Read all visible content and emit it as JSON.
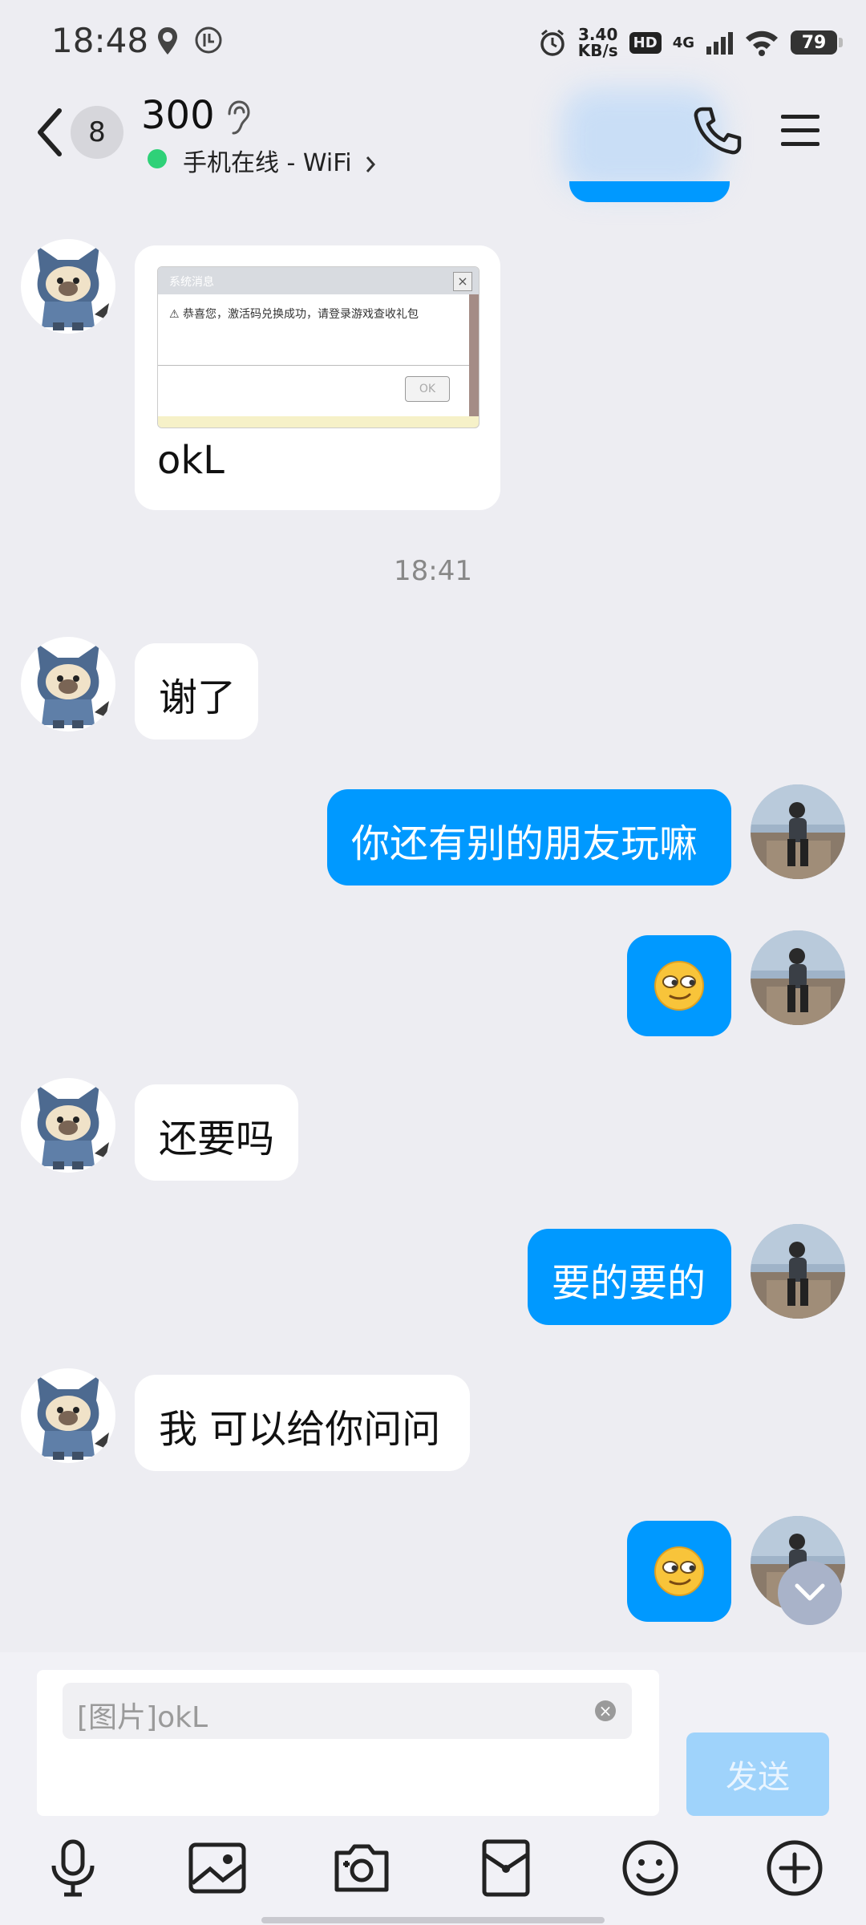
{
  "status_bar": {
    "time": "18:48",
    "net_speed_value": "3.40",
    "net_speed_unit": "KB/s",
    "hd": "HD",
    "signal_type": "4G",
    "battery": "79"
  },
  "header": {
    "unread_count": "8",
    "contact_name": "300",
    "online_status": "手机在线 - WiFi"
  },
  "messages": [
    {
      "side": "in",
      "type": "image",
      "caption": "okL",
      "image": {
        "window_title": "系统消息",
        "text": "恭喜您，激活码兑换成功，请登录游戏查收礼包",
        "button": "OK"
      }
    },
    {
      "type": "timestamp",
      "text": "18:41"
    },
    {
      "side": "in",
      "text": "谢了"
    },
    {
      "side": "out",
      "text": "你还有别的朋友玩嘛"
    },
    {
      "side": "out",
      "type": "emoji",
      "emoji": "smirk-emoji"
    },
    {
      "side": "in",
      "text": "还要吗"
    },
    {
      "side": "out",
      "text": "要的要的"
    },
    {
      "side": "in",
      "text": "我 可以给你问问"
    },
    {
      "side": "out",
      "type": "emoji",
      "emoji": "smirk-emoji"
    }
  ],
  "input": {
    "quote_text": "[图片]okL",
    "send_label": "发送"
  },
  "toolbar": [
    "mic-icon",
    "image-icon",
    "camera-icon",
    "red-packet-icon",
    "emoji-icon",
    "plus-icon"
  ],
  "colors": {
    "accent": "#0099ff",
    "background": "#ededf2",
    "online": "#2fd178",
    "send_disabled": "#9fd3fb"
  }
}
